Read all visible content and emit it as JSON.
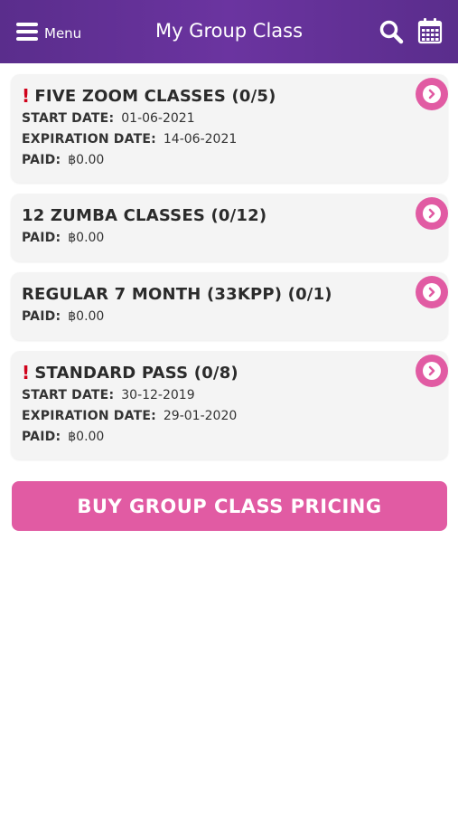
{
  "header": {
    "menu_label": "Menu",
    "title": "My Group Class",
    "icons": {
      "menu": "hamburger-icon",
      "search": "search-icon",
      "calendar": "calendar-icon"
    }
  },
  "colors": {
    "header_bg": "#5a2d8c",
    "accent": "#e15ba3",
    "alert": "#d0021b",
    "card_bg": "#f4f4f4"
  },
  "classes": [
    {
      "title": "FIVE ZOOM CLASSES (0/5)",
      "alert": "!",
      "start_label": "START DATE:",
      "start_value": "01-06-2021",
      "exp_label": "EXPIRATION DATE:",
      "exp_value": "14-06-2021",
      "paid_label": "PAID:",
      "paid_value": "฿0.00"
    },
    {
      "title": "12 ZUMBA CLASSES (0/12)",
      "paid_label": "PAID:",
      "paid_value": "฿0.00"
    },
    {
      "title": "REGULAR 7 MONTH (33KPP) (0/1)",
      "paid_label": "PAID:",
      "paid_value": "฿0.00"
    },
    {
      "title": "STANDARD PASS (0/8)",
      "alert": "!",
      "start_label": "START DATE:",
      "start_value": "30-12-2019",
      "exp_label": "EXPIRATION DATE:",
      "exp_value": "29-01-2020",
      "paid_label": "PAID:",
      "paid_value": "฿0.00"
    }
  ],
  "buy_button_label": "BUY GROUP CLASS PRICING"
}
